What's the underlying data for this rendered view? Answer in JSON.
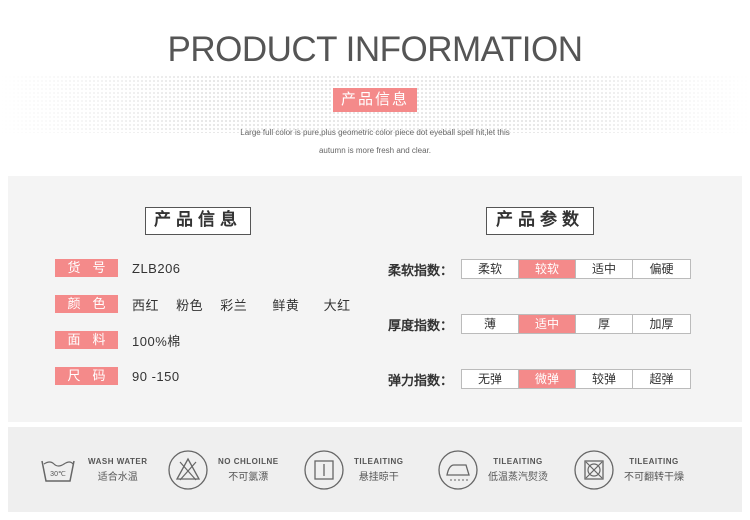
{
  "header": {
    "title": "PRODUCT INFORMATION",
    "badge": "产品信息",
    "desc_line1": "Large full color is pure,plus geometric color piece dot eyeball spell hit,let this",
    "desc_line2": "autumn is more fresh and clear."
  },
  "info": {
    "section_title": "产品信息",
    "rows": [
      {
        "label": "货号",
        "value": "ZLB206"
      },
      {
        "label": "颜色",
        "values": [
          "西红",
          "粉色",
          "彩兰",
          "鲜黄",
          "大红"
        ]
      },
      {
        "label": "面料",
        "value": "100%棉"
      },
      {
        "label": "尺码",
        "value": "90 -150"
      }
    ]
  },
  "params": {
    "section_title": "产品参数",
    "rows": [
      {
        "label": "柔软指数：",
        "options": [
          "柔软",
          "较软",
          "适中",
          "偏硬"
        ],
        "selected": 1
      },
      {
        "label": "厚度指数：",
        "options": [
          "薄",
          "适中",
          "厚",
          "加厚"
        ],
        "selected": 1
      },
      {
        "label": "弹力指数：",
        "options": [
          "无弹",
          "微弹",
          "较弹",
          "超弹"
        ],
        "selected": 1
      }
    ]
  },
  "care": [
    {
      "icon": "wash-30-icon",
      "icon_text": "30℃",
      "en": "WASH WATER",
      "cn": "适合水温"
    },
    {
      "icon": "no-bleach-icon",
      "en": "NO CHLOILNE",
      "cn": "不可氯漂"
    },
    {
      "icon": "hang-dry-icon",
      "en": "TILEAITING",
      "cn": "悬挂晾干"
    },
    {
      "icon": "iron-steam-icon",
      "en": "TILEAITING",
      "cn": "低温蒸汽熨烫"
    },
    {
      "icon": "no-tumble-dry-icon",
      "en": "TILEAITING",
      "cn": "不可翻转干燥"
    }
  ],
  "colors": {
    "accent": "#f48a8a",
    "panel": "#f4f4f4",
    "care_bg": "#efefef"
  }
}
